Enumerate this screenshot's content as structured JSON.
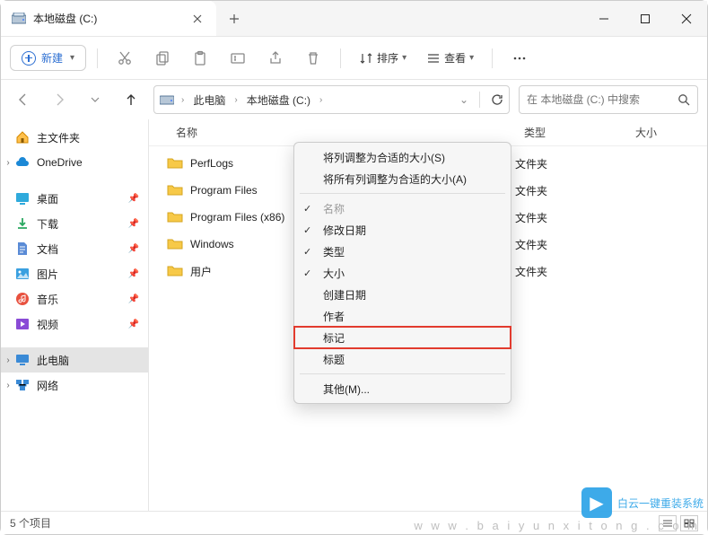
{
  "window": {
    "tab_title": "本地磁盘 (C:)"
  },
  "toolbar": {
    "new_label": "新建",
    "sort_label": "排序",
    "view_label": "查看"
  },
  "breadcrumbs": {
    "item0": "此电脑",
    "item1": "本地磁盘 (C:)"
  },
  "search": {
    "placeholder": "在 本地磁盘 (C:) 中搜索"
  },
  "sidebar": {
    "home": "主文件夹",
    "onedrive": "OneDrive",
    "desktop": "桌面",
    "downloads": "下载",
    "documents": "文档",
    "pictures": "图片",
    "music": "音乐",
    "videos": "视频",
    "thispc": "此电脑",
    "network": "网络"
  },
  "columns": {
    "name": "名称",
    "type": "类型",
    "size": "大小"
  },
  "files": {
    "0": {
      "name": "PerfLogs",
      "type": "文件夹"
    },
    "1": {
      "name": "Program Files",
      "type": "文件夹"
    },
    "2": {
      "name": "Program Files (x86)",
      "type": "文件夹"
    },
    "3": {
      "name": "Windows",
      "type": "文件夹"
    },
    "4": {
      "name": "用户",
      "type": "文件夹"
    }
  },
  "context_menu": {
    "fit_column": "将列调整为合适的大小(S)",
    "fit_all": "将所有列调整为合适的大小(A)",
    "name": "名称",
    "date_modified": "修改日期",
    "type": "类型",
    "size": "大小",
    "date_created": "创建日期",
    "author": "作者",
    "tags": "标记",
    "title": "标题",
    "more": "其他(M)..."
  },
  "status": {
    "count": "5 个项目"
  },
  "watermark": {
    "text": "白云一键重装系统",
    "url": "w w w . b a i y u n x i t o n g . c o m"
  }
}
